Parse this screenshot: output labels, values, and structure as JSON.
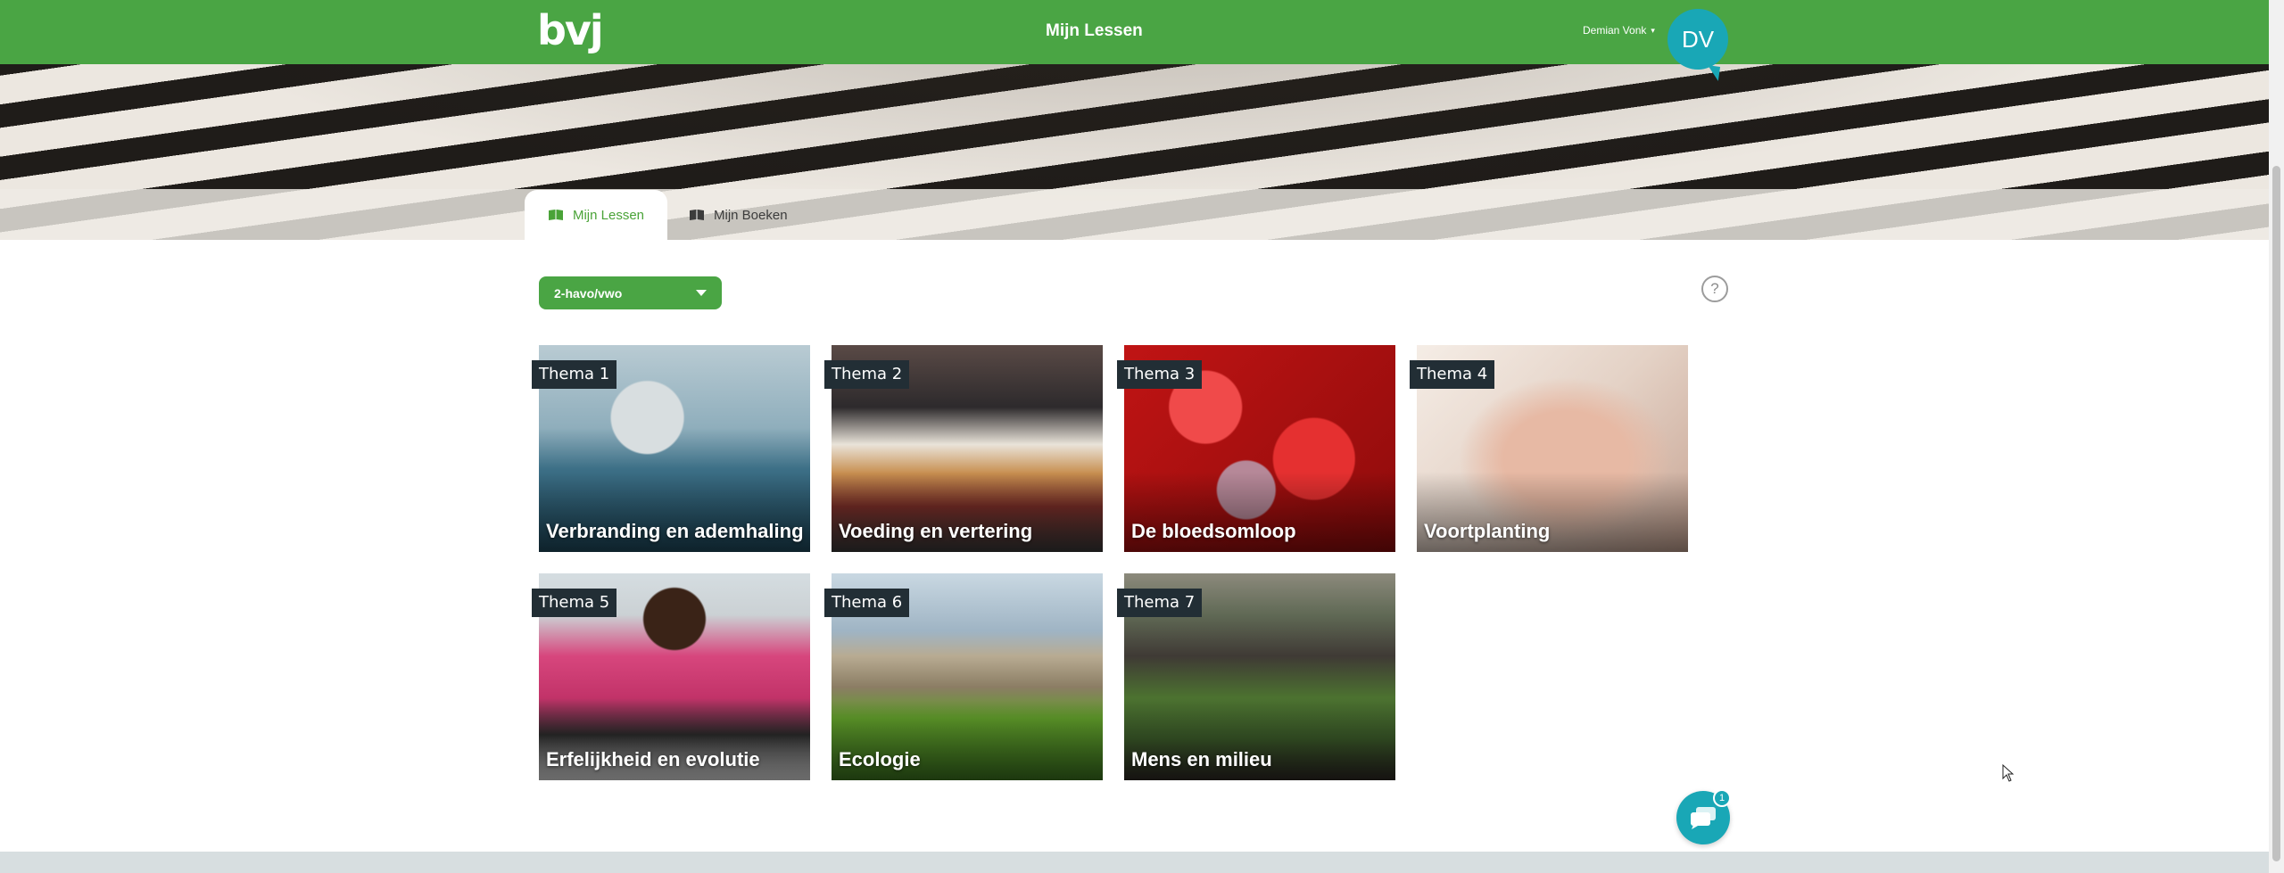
{
  "header": {
    "logo": "bvj",
    "title": "Mijn Lessen",
    "user_name": "Demian Vonk",
    "avatar_initials": "DV",
    "brand_color": "#4aa544",
    "accent_color": "#19a7b6"
  },
  "tabs": [
    {
      "label": "Mijn Lessen",
      "active": true
    },
    {
      "label": "Mijn Boeken",
      "active": false
    }
  ],
  "level_select": {
    "value": "2-havo/vwo"
  },
  "help": {
    "label": "?"
  },
  "themes": [
    {
      "badge": "Thema 1",
      "title": "Verbranding en ademhaling"
    },
    {
      "badge": "Thema 2",
      "title": "Voeding en vertering"
    },
    {
      "badge": "Thema 3",
      "title": "De bloedsomloop"
    },
    {
      "badge": "Thema 4",
      "title": "Voortplanting"
    },
    {
      "badge": "Thema 5",
      "title": "Erfelijkheid en evolutie"
    },
    {
      "badge": "Thema 6",
      "title": "Ecologie"
    },
    {
      "badge": "Thema 7",
      "title": "Mens en milieu"
    }
  ],
  "chat": {
    "unread_count": "1"
  }
}
